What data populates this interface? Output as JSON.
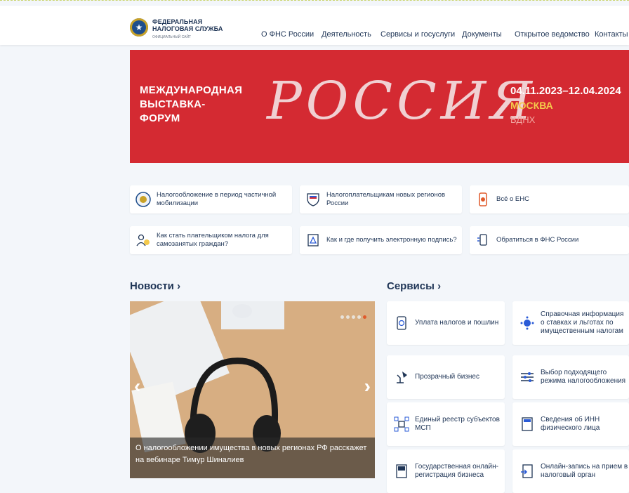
{
  "header": {
    "logo": {
      "line1": "ФЕДЕРАЛЬНАЯ",
      "line2": "НАЛОГОВАЯ СЛУЖБА",
      "line3": "ОФИЦИАЛЬНЫЙ САЙТ"
    },
    "nav": [
      "О ФНС России",
      "Деятельность",
      "Сервисы и госуслуги",
      "Документы",
      "Открытое ведомство",
      "Контакты"
    ]
  },
  "banner": {
    "left_lines": [
      "МЕЖДУНАРОДНАЯ",
      "ВЫСТАВКА-",
      "ФОРУМ"
    ],
    "title": "РОССИЯ",
    "dates": "04.11.2023–12.04.2024",
    "city": "МОСКВА",
    "venue": "ВДНХ"
  },
  "quick_links": [
    {
      "label": "Налогообложение в период частичной мобилизации",
      "icon": "emblem-icon"
    },
    {
      "label": "Налогоплательщикам новых регионов России",
      "icon": "flag-shield-icon"
    },
    {
      "label": "Всё о ЕНС",
      "icon": "ens-phone-icon"
    },
    {
      "label": "Как стать плательщиком налога для самозанятых граждан?",
      "icon": "self-employed-icon"
    },
    {
      "label": "Как и где получить электронную подпись?",
      "icon": "e-signature-icon"
    },
    {
      "label": "Обратиться в ФНС России",
      "icon": "contact-icon"
    }
  ],
  "news": {
    "heading": "Новости",
    "caption": "О налогообложении имущества в новых регионах РФ расскажет на вебинаре Тимур Шиналиев"
  },
  "services": {
    "heading": "Сервисы",
    "items": [
      {
        "label": "Уплата налогов и пошлин",
        "icon": "payment-icon"
      },
      {
        "label": "Справочная информация о ставках и льготах по имущественным налогам",
        "icon": "reference-icon"
      },
      {
        "label": "Прозрачный бизнес",
        "icon": "lamp-icon"
      },
      {
        "label": "Выбор подходящего режима налогообложения",
        "icon": "sliders-icon"
      },
      {
        "label": "Единый реестр субъектов МСП",
        "icon": "registry-icon"
      },
      {
        "label": "Сведения об ИНН физического лица",
        "icon": "inn-icon"
      },
      {
        "label": "Государственная онлайн-регистрация бизнеса",
        "icon": "registration-icon"
      },
      {
        "label": "Онлайн-запись на прием в налоговый орган",
        "icon": "appointment-icon"
      }
    ]
  },
  "colors": {
    "banner_red": "#d42a32",
    "brand_blue": "#1f3556",
    "accent_orange": "#e05a2b"
  }
}
